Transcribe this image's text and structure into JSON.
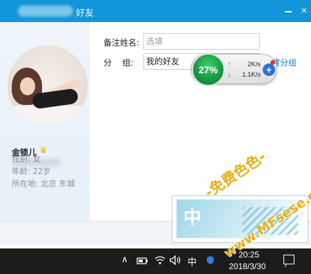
{
  "window": {
    "title": "好友",
    "minimize_glyph": "",
    "close_glyph": "×"
  },
  "profile": {
    "nickname": "金锁儿",
    "gender": "性别: 女",
    "age": "年龄: 22岁",
    "location": "所在地: 北京  东城"
  },
  "form": {
    "remark_label": "备注姓名:",
    "remark_placeholder": "选填",
    "group_label": "分    组:",
    "group_value": "我的好友",
    "new_group_link": "建分组"
  },
  "speed_widget": {
    "percent": "27%",
    "upload": "2K/s",
    "download": "1.1K/s",
    "up_arrow": "↑",
    "down_arrow": "↓",
    "plus": "+"
  },
  "watermark": {
    "tile_char": "中",
    "line1": "-免费色色-",
    "line2": "www.MFsese.com"
  },
  "taskbar": {
    "chevron": "∧",
    "ime": "中",
    "time": "20:25",
    "date": "2018/3/30",
    "icons": [
      "up-chevron-icon",
      "battery-icon",
      "wifi-icon",
      "speaker-icon",
      "ime-icon",
      "notification-icon"
    ]
  },
  "colors": {
    "titlebar": "#1296db",
    "link": "#1a79c8",
    "speed_green": "#1a9a43",
    "taskbar": "#1c1c1c",
    "watermark_gold": "#e7b018"
  }
}
